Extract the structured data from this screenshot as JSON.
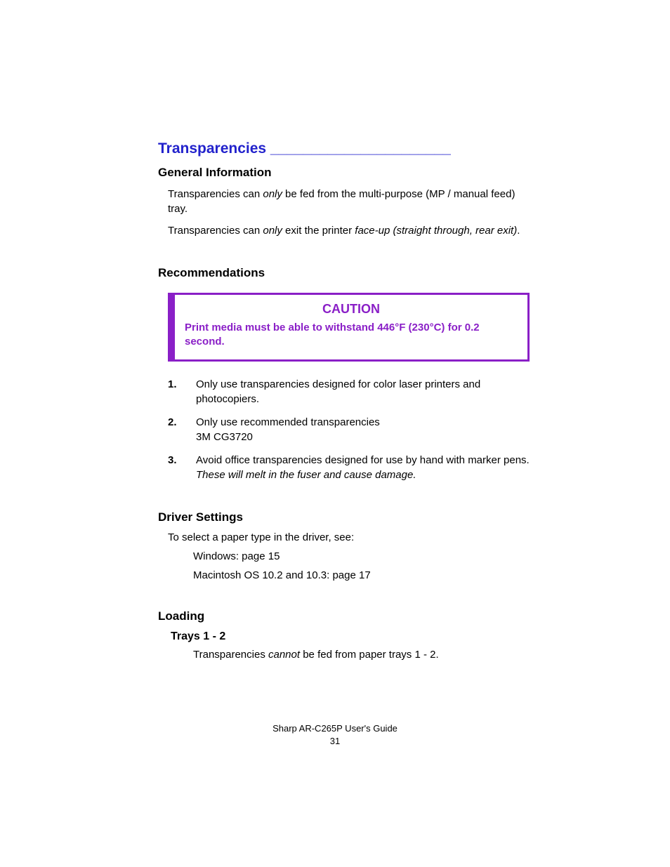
{
  "section_title": "Transparencies ______________________",
  "general": {
    "heading": "General Information",
    "p1_a": "Transparencies can ",
    "p1_i": "only",
    "p1_b": " be fed from the multi-purpose (MP / manual feed) tray.",
    "p2_a": "Transparencies can ",
    "p2_i1": "only",
    "p2_b": " exit the printer ",
    "p2_i2": "face-up (straight through, rear exit)",
    "p2_c": "."
  },
  "recs": {
    "heading": "Recommendations",
    "caution_title": "CAUTION",
    "caution_text": "Print media must be able to withstand 446°F (230°C) for 0.2 second.",
    "items": [
      {
        "num": "1.",
        "text": "Only use transparencies designed for color laser printers and photocopiers."
      },
      {
        "num": "2.",
        "text": "Only use recommended transparencies",
        "line2": "3M CG3720"
      },
      {
        "num": "3.",
        "text": "Avoid office transparencies designed for use by hand with marker pens.",
        "italic": "These will melt in the fuser and cause damage."
      }
    ]
  },
  "driver": {
    "heading": "Driver Settings",
    "intro": "To select a paper type in the driver, see:",
    "win": "Windows:  page 15",
    "mac": "Macintosh OS 10.2 and 10.3:  page 17"
  },
  "loading": {
    "heading": "Loading",
    "sub": "Trays 1 - 2",
    "text_a": "Transparencies ",
    "text_i": "cannot",
    "text_b": " be fed from paper trays 1 - 2."
  },
  "footer": {
    "guide": "Sharp AR-C265P User's Guide",
    "page": "31"
  }
}
